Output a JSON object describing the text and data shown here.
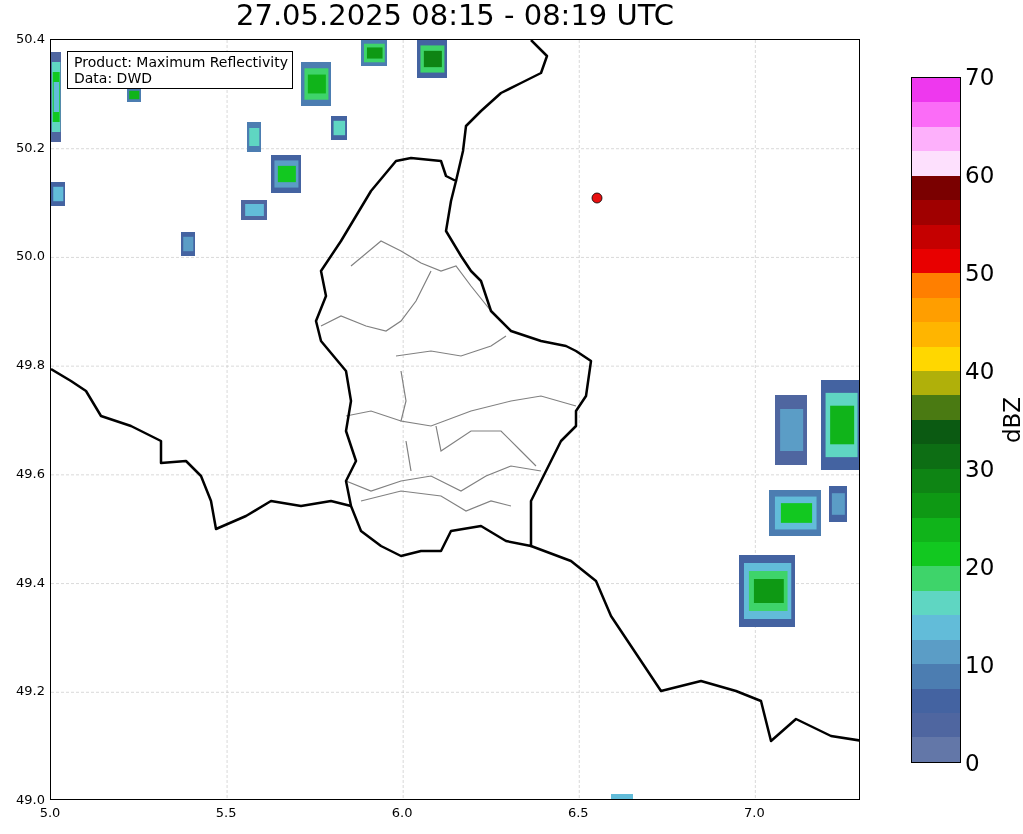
{
  "title": "27.05.2025 08:15 - 08:19 UTC",
  "info_box": {
    "lines": [
      "Product: Maximum Reflectivity",
      "Data: DWD"
    ]
  },
  "map": {
    "kind": "map",
    "y_ticks": [
      "50.4",
      "50.2",
      "50.0",
      "49.8",
      "49.6",
      "49.4",
      "49.2",
      "49.0"
    ],
    "x_ticks": [
      "5.0",
      "5.5",
      "6.0",
      "6.5",
      "7.0"
    ]
  },
  "colorbar": {
    "label": "dBZ",
    "ticks": [
      "70",
      "60",
      "50",
      "40",
      "30",
      "20",
      "10",
      "0"
    ],
    "bins": [
      {
        "color": "#ee38ee"
      },
      {
        "color": "#fb6cf7"
      },
      {
        "color": "#fdb0fb"
      },
      {
        "color": "#fde0fd"
      },
      {
        "color": "#7a0000"
      },
      {
        "color": "#a00000"
      },
      {
        "color": "#c50000"
      },
      {
        "color": "#e80000"
      },
      {
        "color": "#ff7f00"
      },
      {
        "color": "#ff9e00"
      },
      {
        "color": "#ffb500"
      },
      {
        "color": "#ffd700"
      },
      {
        "color": "#b0b00a"
      },
      {
        "color": "#4a7a12"
      },
      {
        "color": "#0b5a12"
      },
      {
        "color": "#0d6e14"
      },
      {
        "color": "#0e8414"
      },
      {
        "color": "#0e9914"
      },
      {
        "color": "#10b41a"
      },
      {
        "color": "#12c820"
      },
      {
        "color": "#3ed46a"
      },
      {
        "color": "#5fd6c2"
      },
      {
        "color": "#62bcd9"
      },
      {
        "color": "#5b9dc6"
      },
      {
        "color": "#4c7db1"
      },
      {
        "color": "#4463a1"
      },
      {
        "color": "#4f66a0"
      },
      {
        "color": "#6377a8"
      }
    ]
  }
}
